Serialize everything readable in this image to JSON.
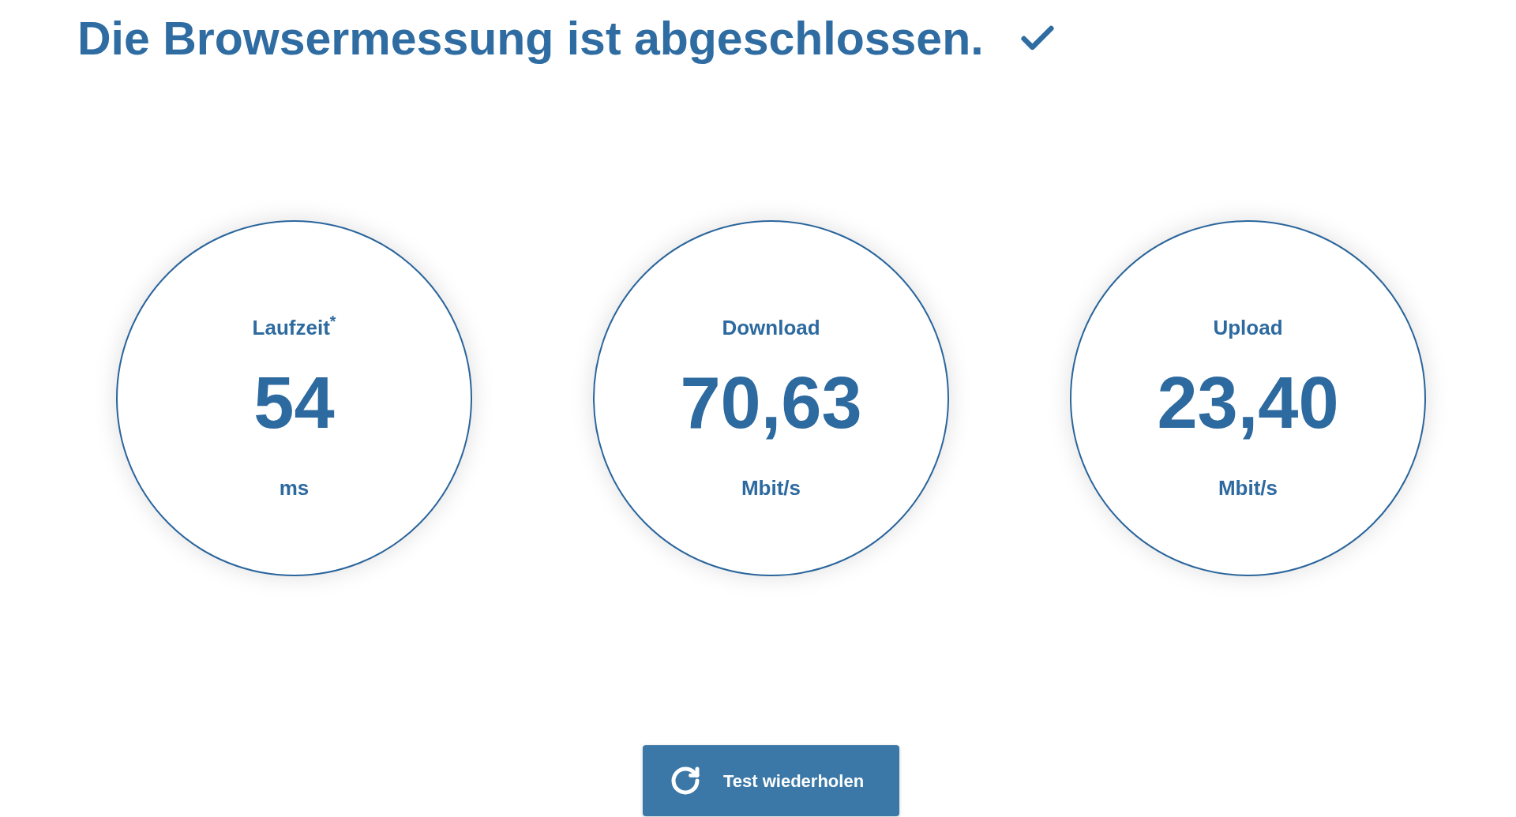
{
  "header": {
    "title": "Die Browsermessung ist abgeschlossen.",
    "completed": true
  },
  "results": [
    {
      "label": "Laufzeit$^{*}$",
      "value": "54",
      "unit": "ms"
    },
    {
      "label": "Download",
      "value": "70,63",
      "unit": "Mbit/s"
    },
    {
      "label": "Upload",
      "value": "23,40",
      "unit": "Mbit/s"
    }
  ],
  "button": {
    "label": "Test wiederholen"
  }
}
